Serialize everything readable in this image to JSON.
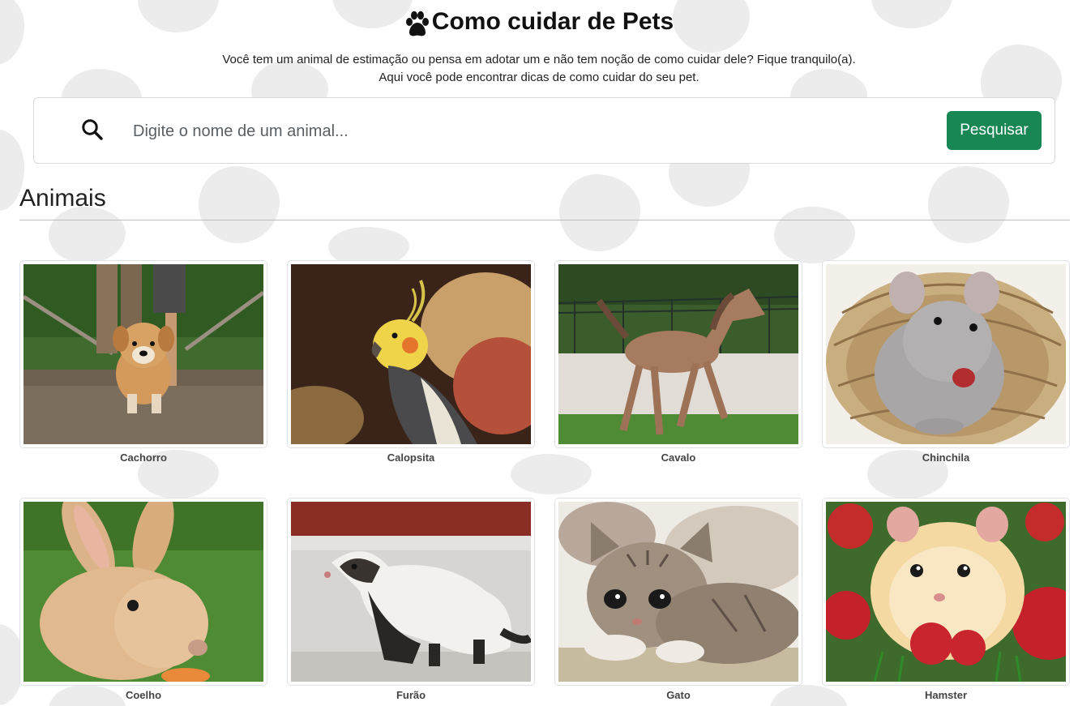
{
  "header": {
    "title": "Como cuidar de Pets",
    "subtitle_line1": "Você tem um animal de estimação ou pensa em adotar um e não tem noção de como cuidar dele? Fique tranquilo(a).",
    "subtitle_line2": "Aqui você pode encontrar dicas de como cuidar do seu pet."
  },
  "search": {
    "placeholder": "Digite o nome de um animal...",
    "value": "",
    "button_label": "Pesquisar",
    "icon": "search-icon"
  },
  "section": {
    "title": "Animais"
  },
  "animals": [
    {
      "name": "Cachorro",
      "image": "puppy-photo"
    },
    {
      "name": "Calopsita",
      "image": "cockatiel-photo"
    },
    {
      "name": "Cavalo",
      "image": "horse-photo"
    },
    {
      "name": "Chinchila",
      "image": "chinchilla-photo"
    },
    {
      "name": "Coelho",
      "image": "rabbit-photo"
    },
    {
      "name": "Furão",
      "image": "ferret-photo"
    },
    {
      "name": "Gato",
      "image": "kitten-photo"
    },
    {
      "name": "Hamster",
      "image": "hamster-photo"
    }
  ],
  "colors": {
    "accent": "#198754",
    "background_spots": "#ececec",
    "text": "#212529"
  }
}
